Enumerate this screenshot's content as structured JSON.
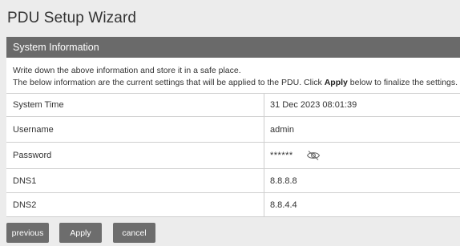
{
  "page": {
    "title": "PDU Setup Wizard"
  },
  "section": {
    "title": "System Information"
  },
  "note": {
    "line1": "Write down the above information and store it in a safe place.",
    "line2_before": "The below information are the current settings that will be applied to the PDU. Click ",
    "line2_bold": "Apply",
    "line2_after": " below to finalize the settings."
  },
  "settings": [
    {
      "label": "System Time",
      "value": "31 Dec 2023 08:01:39"
    },
    {
      "label": "Username",
      "value": "admin"
    },
    {
      "label": "Password",
      "value": "******",
      "icon": "eye-slash-icon"
    },
    {
      "label": "DNS1",
      "value": "8.8.8.8"
    },
    {
      "label": "DNS2",
      "value": "8.8.4.4"
    }
  ],
  "buttons": {
    "previous": "previous",
    "apply": "Apply",
    "cancel": "cancel"
  },
  "colors": {
    "background": "#ececec",
    "header": "#6a6a6a",
    "button": "#6d6d6d",
    "border": "#cfcfcf"
  }
}
